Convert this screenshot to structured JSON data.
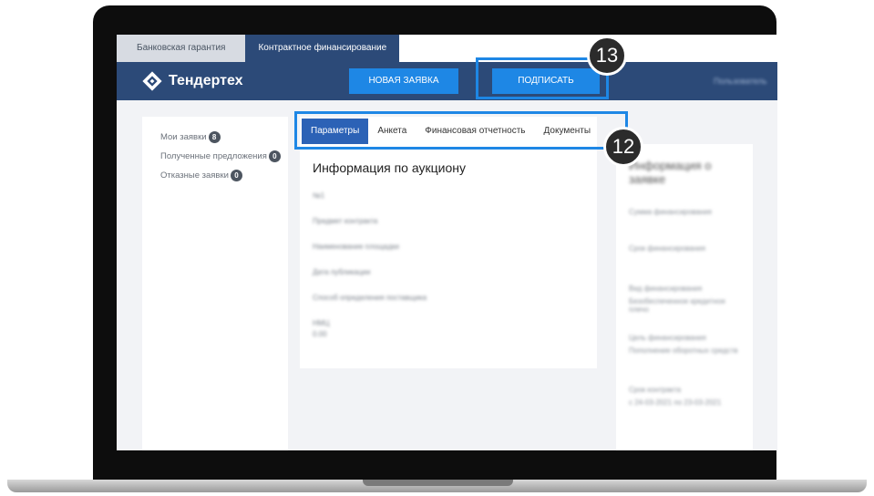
{
  "top_tabs": [
    {
      "label": "Банковская гарантия"
    },
    {
      "label": "Контрактное финансирование"
    }
  ],
  "logo": {
    "name": "Тендертех"
  },
  "navbar": {
    "new_request": "НОВАЯ ЗАЯВКА",
    "sign": "ПОДПИСАТЬ",
    "user": "Пользователь"
  },
  "sidebar": {
    "items": [
      {
        "label": "Мои заявки",
        "count": "8"
      },
      {
        "label": "Полученные предложения",
        "count": "0"
      },
      {
        "label": "Отказные заявки",
        "count": "0"
      }
    ]
  },
  "panel_tabs": [
    "Параметры",
    "Анкета",
    "Финансовая отчетность",
    "Документы"
  ],
  "main": {
    "title": "Информация по аукциону",
    "blurred_lines": [
      "№1",
      "Предмет контракта",
      "Наименование площадки",
      "Дата публикации",
      "Способ определения поставщика",
      "НМЦ",
      "0.00"
    ]
  },
  "right": {
    "title": "Информация о заявке",
    "lines": [
      "Сумма финансирования",
      "Срок финансирования",
      "Вид финансирования",
      "Безобеспеченное кредитное плечо",
      "Цель финансирования",
      "Пополнение оборотных средств",
      "Срок контракта",
      "с 24-03-2021 по 23-03-2021"
    ]
  },
  "annotations": {
    "sign_marker": "13",
    "tabs_marker": "12"
  },
  "colors": {
    "navbar": "#2c4a78",
    "accent": "#1e87e5",
    "tab_active": "#2c62b6",
    "marker": "#2b2b2b"
  }
}
